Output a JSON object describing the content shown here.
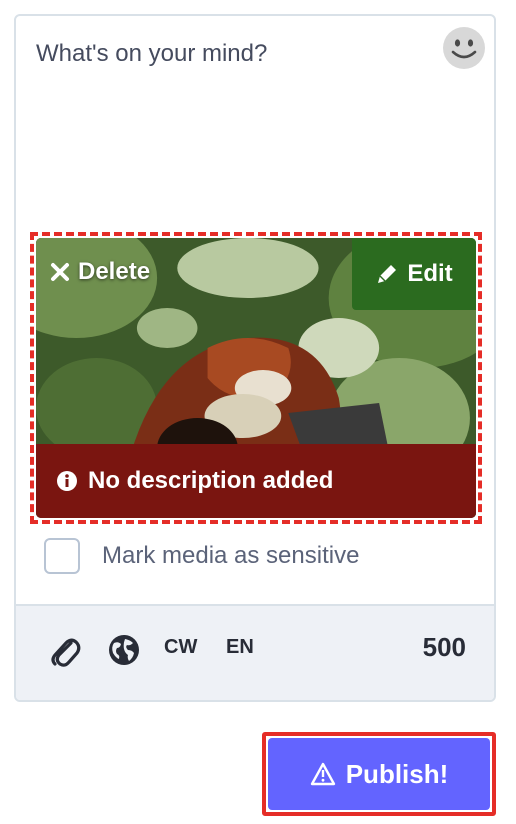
{
  "compose": {
    "placeholder": "What's on your mind?",
    "emoji_icon": "smiley-face-icon"
  },
  "media": {
    "delete_label": "Delete",
    "edit_label": "Edit",
    "description_status": "No description added",
    "delete_icon": "close-x-icon",
    "edit_icon": "pencil-icon",
    "info_icon": "info-circle-icon",
    "colors": {
      "edit_bg": "#2b6b1f",
      "description_bg": "#7a1510",
      "highlight_border": "#e52d27"
    }
  },
  "sensitive": {
    "label": "Mark media as sensitive",
    "checked": false
  },
  "toolbar": {
    "attach_icon": "paperclip-icon",
    "privacy_icon": "globe-icon",
    "cw_label": "CW",
    "language_label": "EN",
    "char_count": "500"
  },
  "publish": {
    "label": "Publish!",
    "icon": "warning-triangle-icon",
    "color": "#6364ff"
  }
}
